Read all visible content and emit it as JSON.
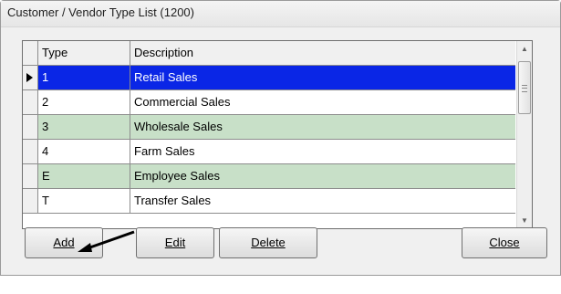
{
  "window": {
    "title": "Customer / Vendor Type List (1200)"
  },
  "grid": {
    "columns": [
      "Type",
      "Description"
    ],
    "rows": [
      {
        "type": "1",
        "description": "Retail Sales",
        "state": "selected"
      },
      {
        "type": "2",
        "description": "Commercial Sales",
        "state": "normal"
      },
      {
        "type": "3",
        "description": "Wholesale Sales",
        "state": "alt"
      },
      {
        "type": "4",
        "description": "Farm Sales",
        "state": "normal"
      },
      {
        "type": "E",
        "description": "Employee Sales",
        "state": "alt"
      },
      {
        "type": "T",
        "description": "Transfer Sales",
        "state": "normal"
      }
    ],
    "colors": {
      "selected_bg": "#0a26e6",
      "alt_bg": "#c8e0c8"
    }
  },
  "buttons": {
    "add": "Add",
    "edit": "Edit",
    "delete": "Delete",
    "close": "Close"
  },
  "icons": {
    "row_indicator": "current-row-triangle-icon",
    "scroll_up": "scroll-up-arrow-icon",
    "scroll_down": "scroll-down-arrow-icon",
    "annotation": "annotation-arrow-icon"
  }
}
